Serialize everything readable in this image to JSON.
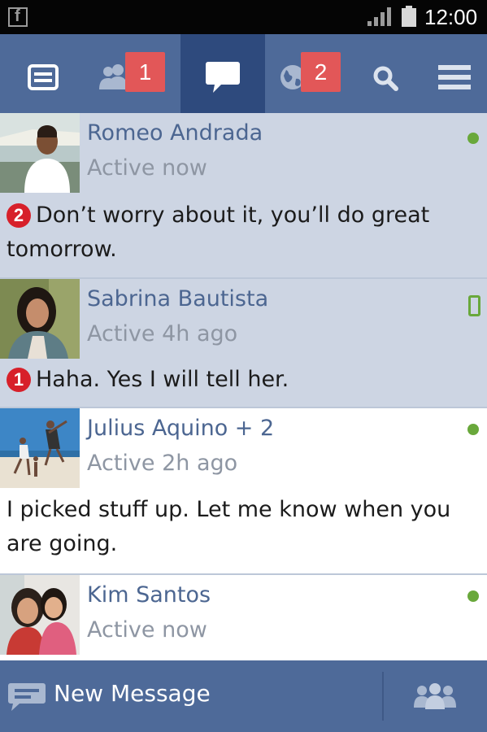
{
  "status_bar": {
    "time": "12:00",
    "app_icon": "facebook-icon",
    "signal_icon": "signal-icon",
    "battery_icon": "battery-icon"
  },
  "nav": {
    "tabs": [
      {
        "icon": "news-feed-icon",
        "badge": ""
      },
      {
        "icon": "friend-requests-icon",
        "badge": "1"
      },
      {
        "icon": "messages-icon",
        "badge": ""
      },
      {
        "icon": "notifications-globe-icon",
        "badge": "2"
      },
      {
        "icon": "search-icon",
        "badge": ""
      },
      {
        "icon": "menu-icon",
        "badge": ""
      }
    ],
    "active_tab": "messages",
    "badge_color": "#e25758",
    "active_color": "#2e4a7d"
  },
  "threads": [
    {
      "name": "Romeo Andrada",
      "status": "Active now",
      "unread_count": "2",
      "preview": "Don’t worry about it, you’ll do great tomorrow.",
      "presence": "online"
    },
    {
      "name": "Sabrina Bautista",
      "status": "Active 4h ago",
      "unread_count": "1",
      "preview": "Haha. Yes I will tell her.",
      "presence": "mobile"
    },
    {
      "name": "Julius Aquino + 2",
      "status": "Active 2h ago",
      "unread_count": "",
      "preview": "I picked stuff up. Let me know when you are going.",
      "presence": "online"
    },
    {
      "name": "Kim Santos",
      "status": "Active now",
      "unread_count": "",
      "preview": "",
      "presence": "online"
    }
  ],
  "bottom_bar": {
    "new_message_label": "New Message",
    "compose_icon": "compose-message-icon",
    "people_icon": "group-people-icon"
  },
  "colors": {
    "brand": "#4e6a99",
    "unread_background": "#cdd5e3",
    "online_dot": "#69a83b",
    "unread_badge": "#d7202a"
  }
}
